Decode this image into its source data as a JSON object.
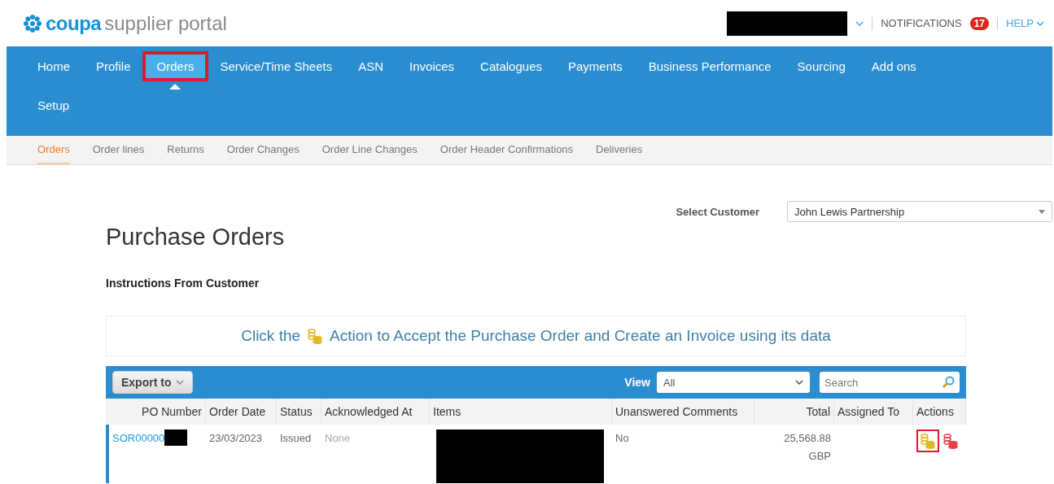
{
  "header": {
    "logo": {
      "brand": "coupa",
      "product": "supplier portal"
    },
    "notifications": {
      "label": "NOTIFICATIONS",
      "count": "17"
    },
    "help": {
      "label": "HELP"
    }
  },
  "nav": {
    "rows": [
      [
        {
          "label": "Home",
          "selected": false,
          "highlighted": false
        },
        {
          "label": "Profile",
          "selected": false,
          "highlighted": false
        },
        {
          "label": "Orders",
          "selected": true,
          "highlighted": true
        },
        {
          "label": "Service/Time Sheets",
          "selected": false,
          "highlighted": false
        },
        {
          "label": "ASN",
          "selected": false,
          "highlighted": false
        },
        {
          "label": "Invoices",
          "selected": false,
          "highlighted": false
        },
        {
          "label": "Catalogues",
          "selected": false,
          "highlighted": false
        },
        {
          "label": "Payments",
          "selected": false,
          "highlighted": false
        },
        {
          "label": "Business Performance",
          "selected": false,
          "highlighted": false
        },
        {
          "label": "Sourcing",
          "selected": false,
          "highlighted": false
        },
        {
          "label": "Add ons",
          "selected": false,
          "highlighted": false
        }
      ],
      [
        {
          "label": "Setup",
          "selected": false,
          "highlighted": false
        }
      ]
    ]
  },
  "subnav": [
    {
      "label": "Orders",
      "selected": true
    },
    {
      "label": "Order lines",
      "selected": false
    },
    {
      "label": "Returns",
      "selected": false
    },
    {
      "label": "Order Changes",
      "selected": false
    },
    {
      "label": "Order Line Changes",
      "selected": false
    },
    {
      "label": "Order Header Confirmations",
      "selected": false
    },
    {
      "label": "Deliveries",
      "selected": false
    }
  ],
  "select_customer": {
    "label": "Select Customer",
    "value": "John Lewis Partnership"
  },
  "title": "Purchase Orders",
  "instructions_label": "Instructions From Customer",
  "banner": {
    "text_before": "Click the",
    "text_after": "Action to Accept the Purchase Order and Create an Invoice using its data"
  },
  "table": {
    "toolbar": {
      "export_button": "Export to",
      "view_label": "View",
      "view_value": "All",
      "search_placeholder": "Search"
    },
    "columns": [
      "PO Number",
      "Order Date",
      "Status",
      "Acknowledged At",
      "Items",
      "Unanswered Comments",
      "Total",
      "Assigned To",
      "Actions"
    ],
    "rows": [
      {
        "po_number": "SOR00000",
        "order_date": "23/03/2023",
        "status": "Issued",
        "acknowledged_at": "None",
        "unanswered_comments": "No",
        "total": "25,568.88",
        "currency": "GBP",
        "actions": [
          {
            "kind": "accept",
            "highlighted": true
          },
          {
            "kind": "reject",
            "highlighted": false
          }
        ]
      }
    ]
  }
}
